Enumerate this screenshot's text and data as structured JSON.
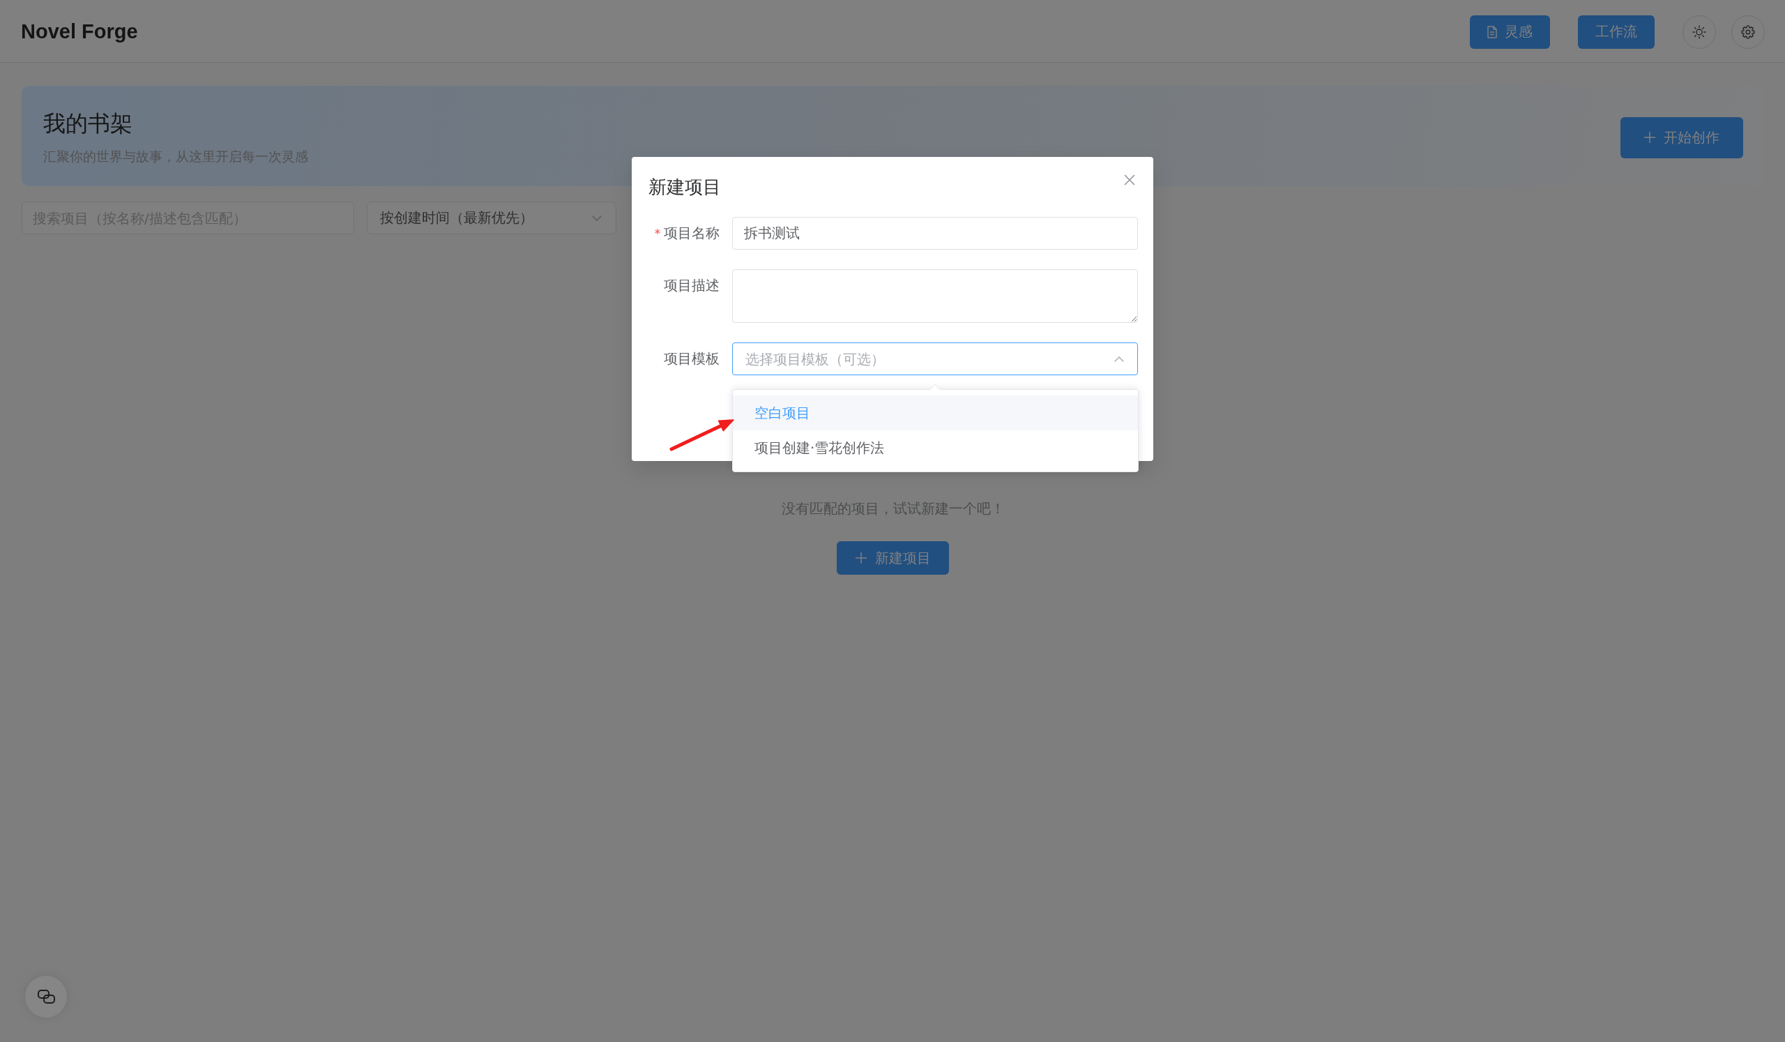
{
  "header": {
    "title": "Novel Forge",
    "buttons": [
      {
        "kind": "icon-label",
        "label": "灵感"
      },
      {
        "kind": "label",
        "label": "工作流"
      }
    ]
  },
  "shelf": {
    "title": "我的书架",
    "subtitle": "汇聚你的世界与故事，从这里开启每一次灵感",
    "action": "开始创作"
  },
  "filters": {
    "search": {
      "placeholder": "搜索项目（按名称/描述包含匹配）"
    },
    "sort": {
      "value": "按创建时间（最新优先）"
    }
  },
  "empty_state": {
    "message": "没有匹配的项目，试试新建一个吧！",
    "action": "新建项目"
  },
  "dialog": {
    "title": "新建项目",
    "fields": [
      {
        "kind": "input",
        "label": "项目名称",
        "required": true,
        "value": "拆书测试"
      },
      {
        "kind": "textarea",
        "label": "项目描述",
        "required": false
      },
      {
        "kind": "select",
        "label": "项目模板",
        "required": false,
        "placeholder": "选择项目模板（可选）",
        "focused": true,
        "expanded": true,
        "options": [
          {
            "label": "空白项目",
            "selected": true
          },
          {
            "label": "项目创建·雪花创作法",
            "selected": false
          }
        ]
      }
    ]
  },
  "annotations": [
    {
      "kind": "arrow"
    }
  ]
}
